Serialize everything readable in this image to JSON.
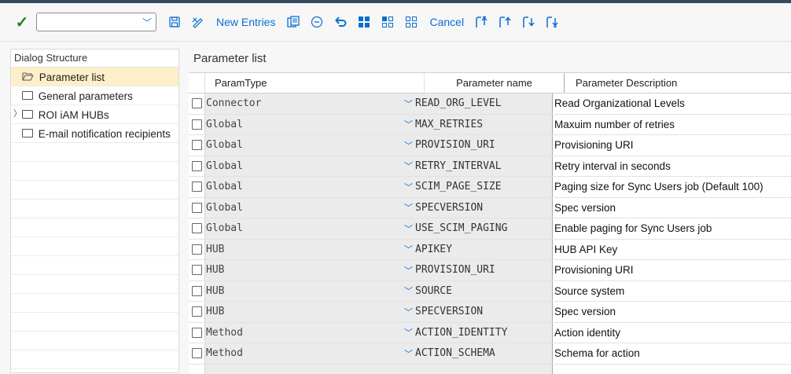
{
  "toolbar": {
    "command_field": {
      "value": ""
    },
    "new_entries_label": "New Entries",
    "cancel_label": "Cancel"
  },
  "dialog_structure": {
    "title": "Dialog Structure",
    "items": [
      {
        "label": "Parameter list",
        "selected": true
      },
      {
        "label": "General parameters"
      },
      {
        "label": "ROI iAM HUBs",
        "expandable": true
      },
      {
        "label": "E-mail notification recipients"
      }
    ]
  },
  "main": {
    "title": "Parameter list",
    "columns": [
      "ParamType",
      "Parameter name",
      "Parameter Description"
    ],
    "rows": [
      {
        "type": "Connector",
        "name": "READ_ORG_LEVEL",
        "desc": "Read Organizational Levels"
      },
      {
        "type": "Global",
        "name": "MAX_RETRIES",
        "desc": "Maxuim number of retries"
      },
      {
        "type": "Global",
        "name": "PROVISION_URI",
        "desc": "Provisioning URI"
      },
      {
        "type": "Global",
        "name": "RETRY_INTERVAL",
        "desc": "Retry interval in seconds"
      },
      {
        "type": "Global",
        "name": "SCIM_PAGE_SIZE",
        "desc": "Paging size for Sync Users job (Default 100)"
      },
      {
        "type": "Global",
        "name": "SPECVERSION",
        "desc": "Spec version"
      },
      {
        "type": "Global",
        "name": "USE_SCIM_PAGING",
        "desc": "Enable paging for Sync Users job"
      },
      {
        "type": "HUB",
        "name": "APIKEY",
        "desc": "HUB API Key"
      },
      {
        "type": "HUB",
        "name": "PROVISION_URI",
        "desc": "Provisioning URI"
      },
      {
        "type": "HUB",
        "name": "SOURCE",
        "desc": "Source system"
      },
      {
        "type": "HUB",
        "name": "SPECVERSION",
        "desc": "Spec version"
      },
      {
        "type": "Method",
        "name": "ACTION_IDENTITY",
        "desc": "Action identity"
      },
      {
        "type": "Method",
        "name": "ACTION_SCHEMA",
        "desc": "Schema for action"
      }
    ]
  },
  "colors": {
    "accent": "#0a6ed1",
    "selected_row": "#fdf0c8",
    "header_bar": "#354a5f"
  }
}
